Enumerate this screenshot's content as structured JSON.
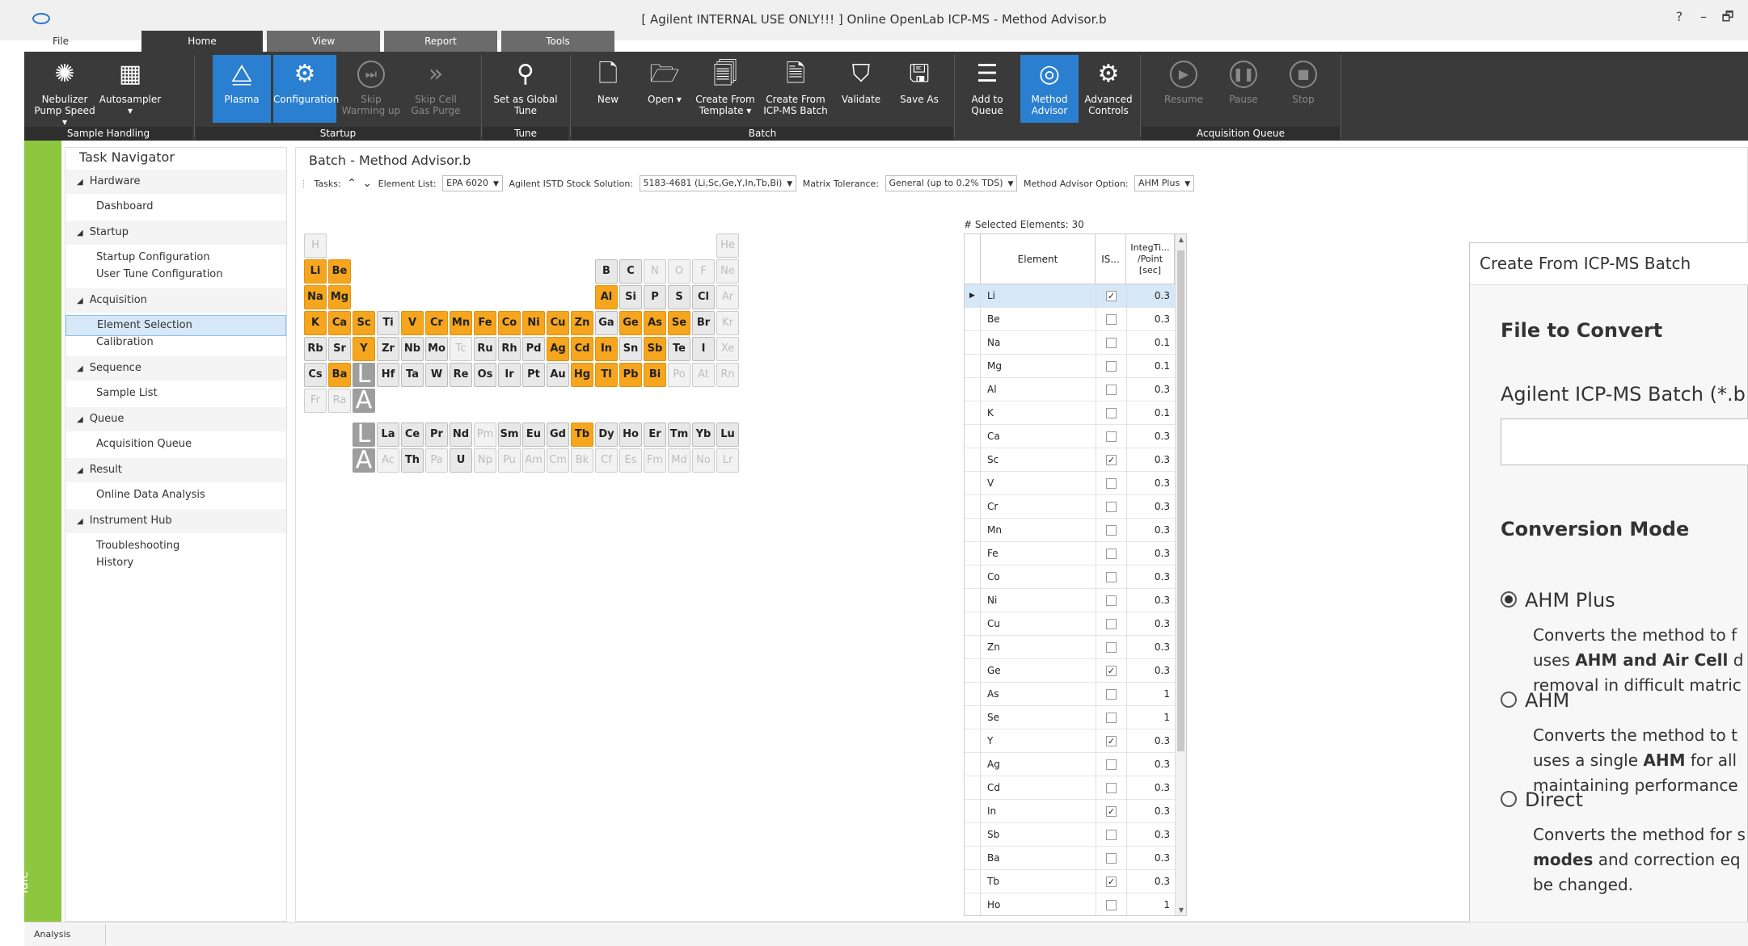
{
  "window": {
    "title": "[ Agilent INTERNAL USE ONLY!!! ] Online OpenLab ICP-MS - Method Advisor.b",
    "controls": [
      "?",
      "–",
      "🗗"
    ]
  },
  "tabs": [
    "File",
    "Home",
    "View",
    "Report",
    "Tools"
  ],
  "ribbon": {
    "buttons": {
      "nebulizer": "Nebulizer Pump Speed ▾",
      "autosampler": "Autosampler ▾",
      "plasma": "Plasma",
      "configuration": "Configuration",
      "skip_warming": "Skip Warming up",
      "skip_cell": "Skip Cell Gas Purge",
      "set_global": "Set as Global Tune",
      "new": "New",
      "open": "Open ▾",
      "create_template": "Create From Template ▾",
      "create_batch": "Create From ICP-MS Batch",
      "validate": "Validate",
      "save_as": "Save As",
      "add_queue": "Add to Queue",
      "method_advisor": "Method Advisor",
      "advanced": "Advanced Controls",
      "resume": "Resume",
      "pause": "Pause",
      "stop": "Stop"
    },
    "groups": [
      "Sample Handling",
      "Startup",
      "Tune",
      "Batch",
      "Acquisition Queue"
    ]
  },
  "status": "Idle",
  "navigator": {
    "title": "Task Navigator",
    "sections": [
      {
        "label": "Hardware",
        "items": [
          "Dashboard"
        ]
      },
      {
        "label": "Startup",
        "items": [
          "Startup Configuration",
          "User Tune Configuration"
        ]
      },
      {
        "label": "Acquisition",
        "items": [
          "Element Selection",
          "Calibration"
        ]
      },
      {
        "label": "Sequence",
        "items": [
          "Sample List"
        ]
      },
      {
        "label": "Queue",
        "items": [
          "Acquisition Queue"
        ]
      },
      {
        "label": "Result",
        "items": [
          "Online Data Analysis"
        ]
      },
      {
        "label": "Instrument Hub",
        "items": [
          "Troubleshooting",
          "History"
        ]
      }
    ],
    "selected": "Element Selection"
  },
  "batch": {
    "title": "Batch - Method Advisor.b",
    "options": {
      "tasks_label": "Tasks:",
      "element_list_label": "Element List:",
      "element_list": "EPA 6020",
      "istd_label": "Agilent ISTD Stock Solution:",
      "istd": "5183-4681 (Li,Sc,Ge,Y,In,Tb,Bi)",
      "matrix_label": "Matrix Tolerance:",
      "matrix": "General (up to 0.2% TDS)",
      "advisor_label": "Method Advisor Option:",
      "advisor": "AHM Plus"
    },
    "selected_count": "# Selected Elements: 30",
    "grid_headers": {
      "element": "Element",
      "is": "IS...",
      "integ": "IntegTi... /Point [sec]"
    },
    "rows": [
      {
        "el": "Li",
        "is": true,
        "val": "0.3"
      },
      {
        "el": "Be",
        "is": false,
        "val": "0.3"
      },
      {
        "el": "Na",
        "is": false,
        "val": "0.1"
      },
      {
        "el": "Mg",
        "is": false,
        "val": "0.1"
      },
      {
        "el": "Al",
        "is": false,
        "val": "0.3"
      },
      {
        "el": "K",
        "is": false,
        "val": "0.1"
      },
      {
        "el": "Ca",
        "is": false,
        "val": "0.3"
      },
      {
        "el": "Sc",
        "is": true,
        "val": "0.3"
      },
      {
        "el": "V",
        "is": false,
        "val": "0.3"
      },
      {
        "el": "Cr",
        "is": false,
        "val": "0.3"
      },
      {
        "el": "Mn",
        "is": false,
        "val": "0.3"
      },
      {
        "el": "Fe",
        "is": false,
        "val": "0.3"
      },
      {
        "el": "Co",
        "is": false,
        "val": "0.3"
      },
      {
        "el": "Ni",
        "is": false,
        "val": "0.3"
      },
      {
        "el": "Cu",
        "is": false,
        "val": "0.3"
      },
      {
        "el": "Zn",
        "is": false,
        "val": "0.3"
      },
      {
        "el": "Ge",
        "is": true,
        "val": "0.3"
      },
      {
        "el": "As",
        "is": false,
        "val": "1"
      },
      {
        "el": "Se",
        "is": false,
        "val": "1"
      },
      {
        "el": "Y",
        "is": true,
        "val": "0.3"
      },
      {
        "el": "Ag",
        "is": false,
        "val": "0.3"
      },
      {
        "el": "Cd",
        "is": false,
        "val": "0.3"
      },
      {
        "el": "In",
        "is": true,
        "val": "0.3"
      },
      {
        "el": "Sb",
        "is": false,
        "val": "0.3"
      },
      {
        "el": "Ba",
        "is": false,
        "val": "0.3"
      },
      {
        "el": "Tb",
        "is": true,
        "val": "0.3"
      },
      {
        "el": "Ho",
        "is": false,
        "val": "1"
      }
    ]
  },
  "periodic": {
    "main": [
      [
        "H:d",
        "",
        "",
        "",
        "",
        "",
        "",
        "",
        "",
        "",
        "",
        "",
        "",
        "",
        "",
        "",
        "",
        "He:d"
      ],
      [
        "Li:o",
        "Be:o",
        "",
        "",
        "",
        "",
        "",
        "",
        "",
        "",
        "",
        "",
        "B:n",
        "C:n",
        "N:d",
        "O:d",
        "F:d",
        "Ne:d"
      ],
      [
        "Na:o",
        "Mg:o",
        "",
        "",
        "",
        "",
        "",
        "",
        "",
        "",
        "",
        "",
        "Al:o",
        "Si:n",
        "P:n",
        "S:n",
        "Cl:n",
        "Ar:d"
      ],
      [
        "K:o",
        "Ca:o",
        "Sc:o",
        "Ti:n",
        "V:o",
        "Cr:o",
        "Mn:o",
        "Fe:o",
        "Co:o",
        "Ni:o",
        "Cu:o",
        "Zn:o",
        "Ga:n",
        "Ge:o",
        "As:o",
        "Se:o",
        "Br:n",
        "Kr:d"
      ],
      [
        "Rb:n",
        "Sr:n",
        "Y:o",
        "Zr:n",
        "Nb:n",
        "Mo:n",
        "Tc:d",
        "Ru:n",
        "Rh:n",
        "Pd:n",
        "Ag:o",
        "Cd:o",
        "In:o",
        "Sn:n",
        "Sb:o",
        "Te:n",
        "I:n",
        "Xe:d"
      ],
      [
        "Cs:n",
        "Ba:o",
        "L:big",
        "Hf:n",
        "Ta:n",
        "W:n",
        "Re:n",
        "Os:n",
        "Ir:n",
        "Pt:n",
        "Au:n",
        "Hg:o",
        "Tl:o",
        "Pb:o",
        "Bi:o",
        "Po:d",
        "At:d",
        "Rn:d"
      ],
      [
        "Fr:d",
        "Ra:d",
        "A:big"
      ]
    ],
    "lanthanides": [
      "L:big",
      "La:n",
      "Ce:n",
      "Pr:n",
      "Nd:n",
      "Pm:d",
      "Sm:n",
      "Eu:n",
      "Gd:n",
      "Tb:o",
      "Dy:n",
      "Ho:n",
      "Er:n",
      "Tm:n",
      "Yb:n",
      "Lu:n"
    ],
    "actinides": [
      "A:big",
      "Ac:d",
      "Th:n",
      "Pa:d",
      "U:n",
      "Np:d",
      "Pu:d",
      "Am:d",
      "Cm:d",
      "Bk:d",
      "Cf:d",
      "Es:d",
      "Fm:d",
      "Md:d",
      "No:d",
      "Lr:d"
    ]
  },
  "dialog": {
    "title": "Create From ICP-MS Batch",
    "file_section": "File to Convert",
    "file_label": "Agilent ICP-MS Batch (*.b",
    "file_value": "",
    "mode_section": "Conversion Mode",
    "modes": [
      {
        "label": "AHM Plus",
        "selected": true,
        "desc": [
          "Converts the method to f",
          "uses |AHM and Air Cell| d",
          "removal in difficult matric"
        ]
      },
      {
        "label": "AHM",
        "selected": false,
        "desc": [
          "Converts the method to t",
          "uses a single |AHM| for all",
          "maintaining performance"
        ]
      },
      {
        "label": "Direct",
        "selected": false,
        "desc": [
          "Converts the method for s",
          "|modes| and correction eq",
          "be changed."
        ]
      }
    ]
  },
  "statusbar": {
    "text": "Analysis"
  },
  "colors": {
    "accent": "#2b7fd0",
    "ribbon": "#3a3a3a",
    "status_green": "#8dc63f",
    "element_on": "#f5a51e"
  }
}
